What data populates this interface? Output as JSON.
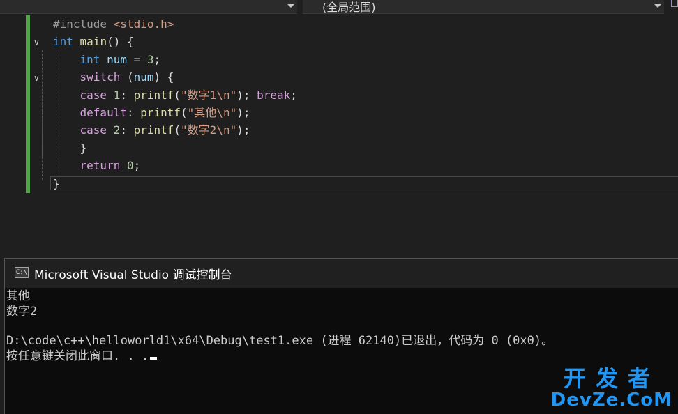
{
  "toolbar": {
    "scope_dropdown_value": "(全局范围)"
  },
  "editor": {
    "lines": [
      [
        {
          "t": "#include ",
          "c": "pre"
        },
        {
          "t": "<stdio.h>",
          "c": "inc"
        }
      ],
      [
        {
          "t": "int",
          "c": "kw"
        },
        {
          "t": " ",
          "c": "plain"
        },
        {
          "t": "main",
          "c": "fn"
        },
        {
          "t": "() {",
          "c": "plain"
        }
      ],
      [
        {
          "t": "    ",
          "c": "plain"
        },
        {
          "t": "int",
          "c": "kw"
        },
        {
          "t": " ",
          "c": "plain"
        },
        {
          "t": "num",
          "c": "var"
        },
        {
          "t": " = ",
          "c": "plain"
        },
        {
          "t": "3",
          "c": "num"
        },
        {
          "t": ";",
          "c": "plain"
        }
      ],
      [
        {
          "t": "    ",
          "c": "plain"
        },
        {
          "t": "switch",
          "c": "kw2"
        },
        {
          "t": " (",
          "c": "plain"
        },
        {
          "t": "num",
          "c": "var"
        },
        {
          "t": ") {",
          "c": "plain"
        }
      ],
      [
        {
          "t": "    ",
          "c": "plain"
        },
        {
          "t": "case",
          "c": "kw2"
        },
        {
          "t": " ",
          "c": "plain"
        },
        {
          "t": "1",
          "c": "num"
        },
        {
          "t": ": ",
          "c": "plain"
        },
        {
          "t": "printf",
          "c": "fn"
        },
        {
          "t": "(",
          "c": "plain"
        },
        {
          "t": "\"数字1\\n\"",
          "c": "str"
        },
        {
          "t": "); ",
          "c": "plain"
        },
        {
          "t": "break",
          "c": "kw2"
        },
        {
          "t": ";",
          "c": "plain"
        }
      ],
      [
        {
          "t": "    ",
          "c": "plain"
        },
        {
          "t": "default",
          "c": "kw2"
        },
        {
          "t": ": ",
          "c": "plain"
        },
        {
          "t": "printf",
          "c": "fn"
        },
        {
          "t": "(",
          "c": "plain"
        },
        {
          "t": "\"其他\\n\"",
          "c": "str"
        },
        {
          "t": ");",
          "c": "plain"
        }
      ],
      [
        {
          "t": "    ",
          "c": "plain"
        },
        {
          "t": "case",
          "c": "kw2"
        },
        {
          "t": " ",
          "c": "plain"
        },
        {
          "t": "2",
          "c": "num"
        },
        {
          "t": ": ",
          "c": "plain"
        },
        {
          "t": "printf",
          "c": "fn"
        },
        {
          "t": "(",
          "c": "plain"
        },
        {
          "t": "\"数字2\\n\"",
          "c": "str"
        },
        {
          "t": ");",
          "c": "plain"
        }
      ],
      [
        {
          "t": "    }",
          "c": "plain"
        }
      ],
      [
        {
          "t": "    ",
          "c": "plain"
        },
        {
          "t": "return",
          "c": "kw2"
        },
        {
          "t": " ",
          "c": "plain"
        },
        {
          "t": "0",
          "c": "num"
        },
        {
          "t": ";",
          "c": "plain"
        }
      ],
      [
        {
          "t": "}",
          "c": "plain"
        }
      ]
    ]
  },
  "console": {
    "title": "Microsoft Visual Studio 调试控制台",
    "icon_label": "C:\\",
    "output": [
      "其他",
      "数字2",
      "",
      "D:\\code\\c++\\helloworld1\\x64\\Debug\\test1.exe (进程 62140)已退出，代码为 0 (0x0)。",
      "按任意键关闭此窗口. . ."
    ]
  },
  "watermark": {
    "line1": "开发者",
    "line2": "DevZe.CoM"
  },
  "colors": {
    "keyword": "#569cd6",
    "control_keyword": "#d8a0df",
    "string": "#d69d85",
    "number": "#b5cea8",
    "variable": "#9cdcfe",
    "function": "#dcdcaa",
    "change_bar": "#51a349",
    "watermark": "#2196f3"
  }
}
